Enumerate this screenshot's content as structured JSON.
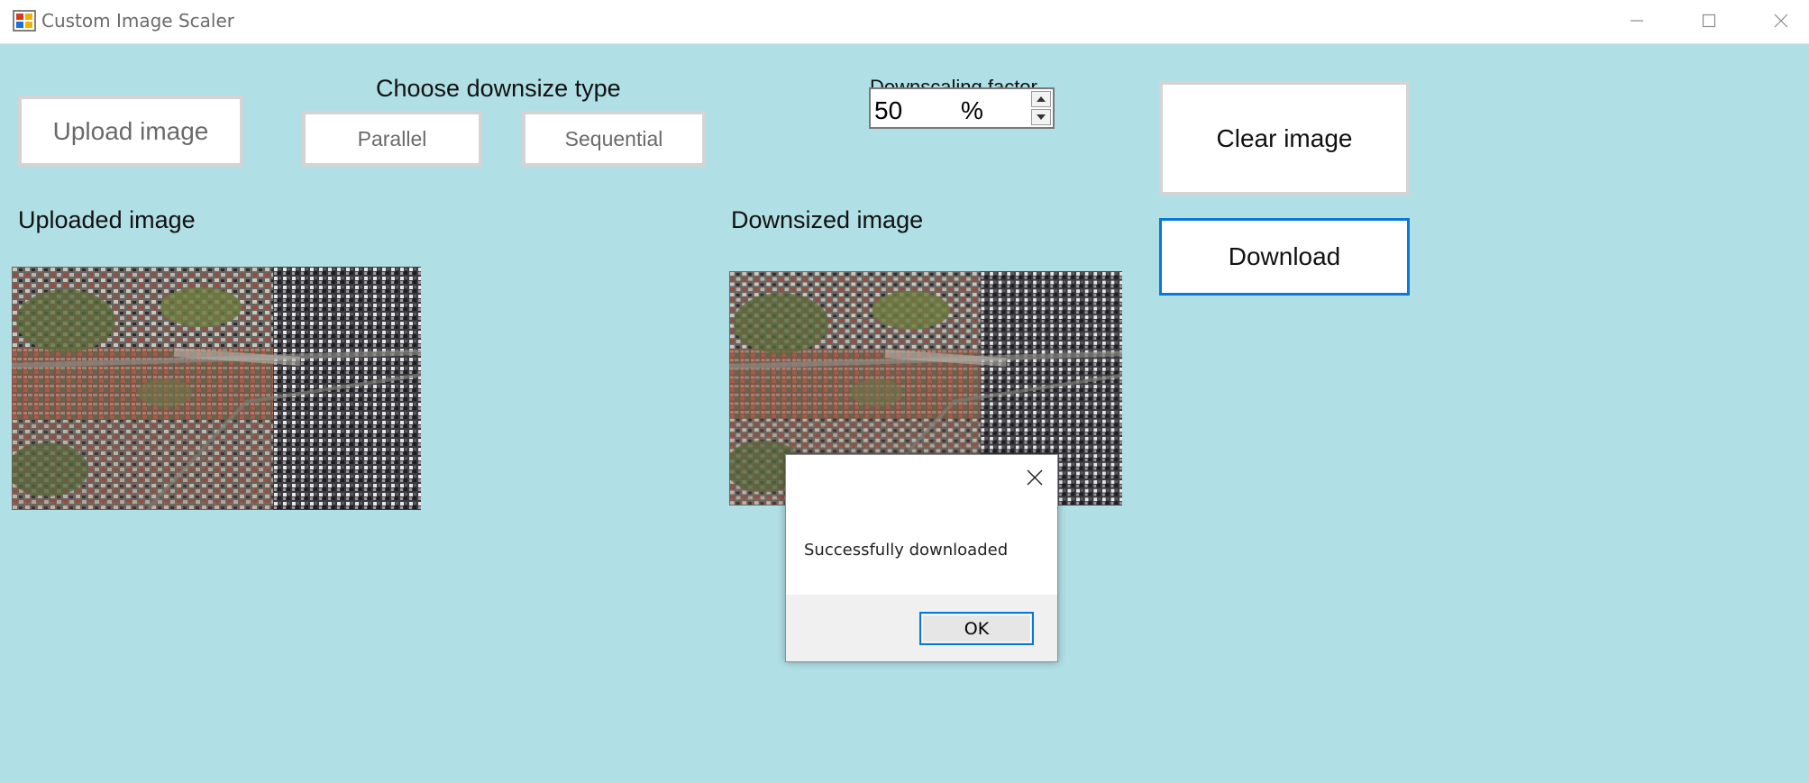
{
  "window": {
    "title": "Custom Image Scaler",
    "icon": "app-icon",
    "controls": {
      "minimize": "minimize-icon",
      "maximize": "maximize-icon",
      "close": "close-icon"
    }
  },
  "toolbar": {
    "upload_label": "Upload image",
    "downsize_type_heading": "Choose downsize type",
    "parallel_label": "Parallel",
    "sequential_label": "Sequential",
    "factor_heading": "Downscaling factor",
    "factor_value": "50",
    "factor_unit": "%",
    "clear_label": "Clear image",
    "download_label": "Download"
  },
  "panels": {
    "uploaded_title": "Uploaded image",
    "downsized_title": "Downsized image"
  },
  "dialog": {
    "message": "Successfully downloaded",
    "ok_label": "OK"
  },
  "colors": {
    "background": "#b0dfe5",
    "focus_accent": "#0a78d7"
  }
}
